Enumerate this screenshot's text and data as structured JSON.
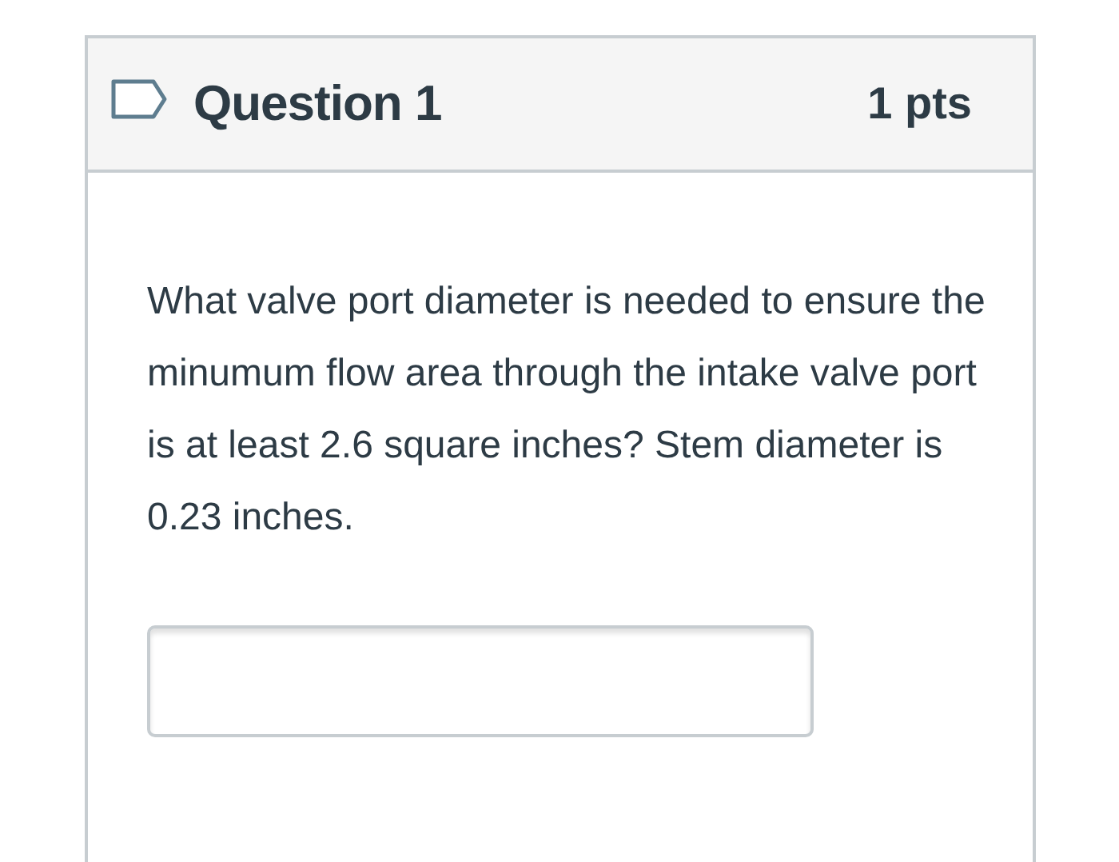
{
  "question": {
    "title": "Question 1",
    "points": "1 pts",
    "text": "What valve port diameter is needed to ensure the minumum flow area through the intake valve port is at least 2.6 square inches? Stem diameter is 0.23 inches."
  }
}
